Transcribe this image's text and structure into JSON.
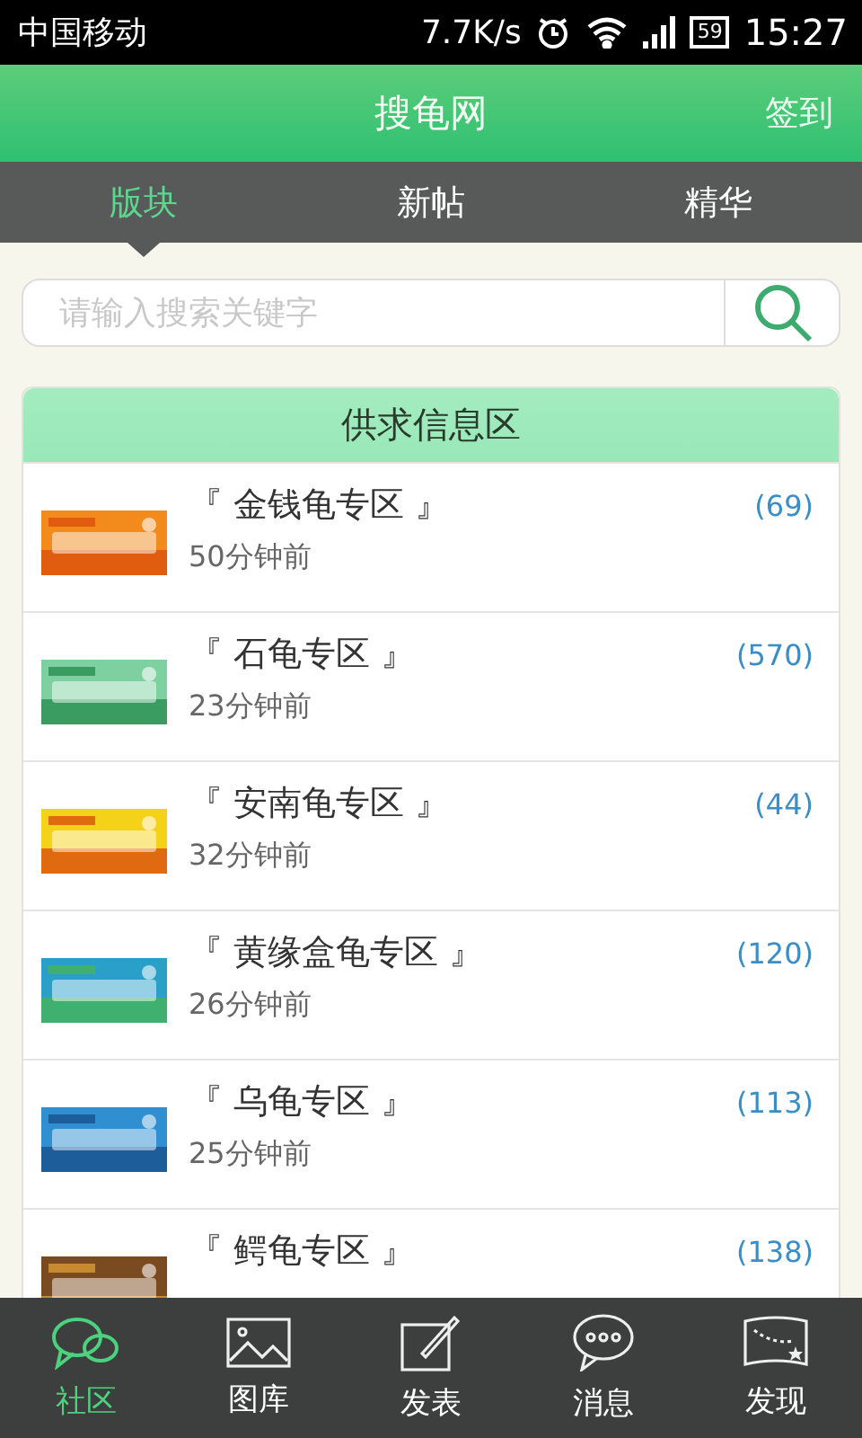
{
  "status_bar": {
    "carrier": "中国移动",
    "speed": "7.7K/s",
    "battery": "59",
    "time": "15:27"
  },
  "header": {
    "title": "搜龟网",
    "action": "签到"
  },
  "tabs": [
    {
      "label": "版块",
      "selected": true
    },
    {
      "label": "新帖",
      "selected": false
    },
    {
      "label": "精华",
      "selected": false
    }
  ],
  "search": {
    "placeholder": "请输入搜索关键字"
  },
  "section": {
    "title": "供求信息区",
    "items": [
      {
        "title": "『 金钱龟专区 』",
        "count": "(69)",
        "time": "50分钟前"
      },
      {
        "title": "『 石龟专区 』",
        "count": "(570)",
        "time": "23分钟前"
      },
      {
        "title": "『 安南龟专区 』",
        "count": "(44)",
        "time": "32分钟前"
      },
      {
        "title": "『 黄缘盒龟专区 』",
        "count": "(120)",
        "time": "26分钟前"
      },
      {
        "title": "『 乌龟专区 』",
        "count": "(113)",
        "time": "25分钟前"
      },
      {
        "title": "『 鳄龟专区 』",
        "count": "(138)"
      }
    ]
  },
  "bottom_nav": [
    {
      "label": "社区",
      "selected": true
    },
    {
      "label": "图库",
      "selected": false
    },
    {
      "label": "发表",
      "selected": false
    },
    {
      "label": "消息",
      "selected": false
    },
    {
      "label": "发现",
      "selected": false
    }
  ]
}
